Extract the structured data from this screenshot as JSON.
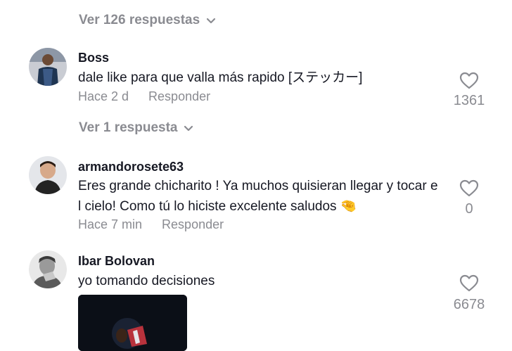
{
  "thread1_view_replies": "Ver 126 respuestas",
  "comments": [
    {
      "username": "Boss",
      "text": "dale like para que valla más rapido [ステッカー]",
      "time": "Hace 2 d",
      "reply_label": "Responder",
      "likes": "1361",
      "view_replies": "Ver 1 respuesta"
    },
    {
      "username": "armandorosete63",
      "text_line1": "Eres grande chicharito ! Ya muchos quisieran llegar y tocar e",
      "text_line2": "l cielo! Como tú lo hiciste excelente saludos",
      "emoji": "🤏",
      "time": "Hace 7 min",
      "reply_label": "Responder",
      "likes": "0"
    },
    {
      "username": "Ibar Bolovan",
      "text": "yo tomando decisiones",
      "likes": "6678"
    }
  ]
}
